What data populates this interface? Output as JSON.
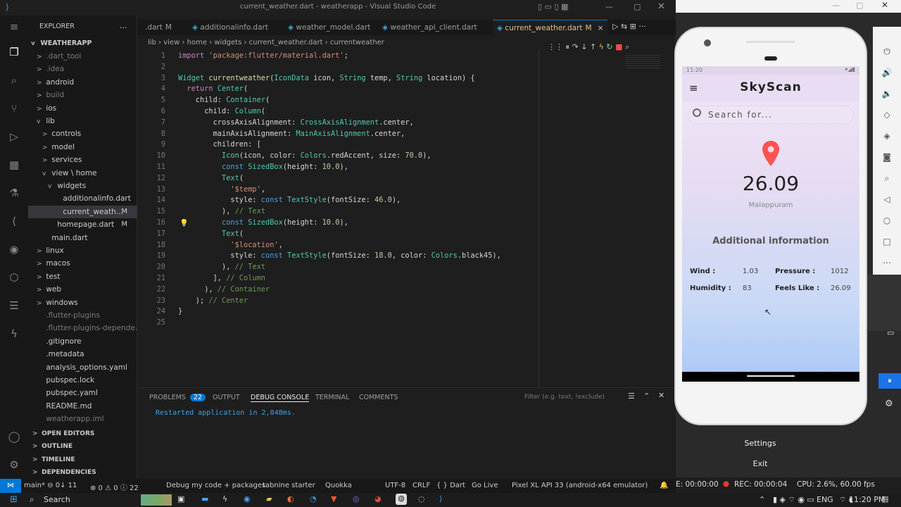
{
  "window_title": "current_weather.dart - weatherapp - Visual Studio Code",
  "explorer_label": "EXPLORER",
  "explorer_more": "...",
  "project": "WEATHERAPP",
  "tree": [
    {
      "label": ".dart_tool",
      "dim": true,
      "chev": ">"
    },
    {
      "label": ".idea",
      "dim": true,
      "chev": ">"
    },
    {
      "label": "android",
      "chev": ">"
    },
    {
      "label": "build",
      "dim": true,
      "chev": ">"
    },
    {
      "label": "ios",
      "chev": ">"
    },
    {
      "label": "lib",
      "chev": "v"
    },
    {
      "label": "controls",
      "chev": ">"
    },
    {
      "label": "model",
      "chev": ">"
    },
    {
      "label": "services",
      "chev": ">"
    },
    {
      "label": "view \\ home",
      "chev": "v"
    },
    {
      "label": "widgets",
      "chev": "v"
    },
    {
      "label": "additionalinfo.dart",
      "chev": ""
    },
    {
      "label": "current_weath...",
      "chev": "",
      "m": "M",
      "sel": true
    },
    {
      "label": "homepage.dart",
      "chev": "",
      "m": "M"
    },
    {
      "label": "main.dart",
      "chev": ""
    },
    {
      "label": "linux",
      "chev": ">"
    },
    {
      "label": "macos",
      "chev": ">"
    },
    {
      "label": "test",
      "chev": ">"
    },
    {
      "label": "web",
      "chev": ">"
    },
    {
      "label": "windows",
      "chev": ">"
    },
    {
      "label": ".flutter-plugins",
      "dim": true,
      "chev": ""
    },
    {
      "label": ".flutter-plugins-depende...",
      "dim": true,
      "chev": ""
    },
    {
      "label": ".gitignore",
      "chev": ""
    },
    {
      "label": ".metadata",
      "chev": ""
    },
    {
      "label": "analysis_options.yaml",
      "chev": ""
    },
    {
      "label": "pubspec.lock",
      "chev": ""
    },
    {
      "label": "pubspec.yaml",
      "chev": ""
    },
    {
      "label": "README.md",
      "chev": ""
    },
    {
      "label": "weatherapp.iml",
      "dim": true,
      "chev": ""
    }
  ],
  "sections": [
    "OPEN EDITORS",
    "OUTLINE",
    "TIMELINE",
    "DEPENDENCIES"
  ],
  "tabs": [
    {
      "label": ".dart",
      "m": "M"
    },
    {
      "label": "additionalinfo.dart"
    },
    {
      "label": "weather_model.dart"
    },
    {
      "label": "weather_api_client.dart"
    },
    {
      "label": "current_weather.dart",
      "m": "M",
      "active": true
    }
  ],
  "tab_close": "×",
  "breadcrumb": [
    "lib",
    "view",
    "home",
    "widgets",
    "current_weather.dart",
    "currentweather"
  ],
  "code_lines": [
    "import 'package:flutter/material.dart';",
    "",
    "Widget currentweather(IconData icon, String temp, String location) {",
    "  return Center(",
    "    child: Container(",
    "      child: Column(",
    "        crossAxisAlignment: CrossAxisAlignment.center,",
    "        mainAxisAlignment: MainAxisAlignment.center,",
    "        children: [",
    "          Icon(icon, color: Colors.redAccent, size: 70.0),",
    "          const SizedBox(height: 10.0),",
    "          Text(",
    "            '$temp',",
    "            style: const TextStyle(fontSize: 46.0),",
    "          ), // Text",
    "          const SizedBox(height: 10.0),",
    "          Text(",
    "            '$location',",
    "            style: const TextStyle(fontSize: 18.0, color: Colors.black45),",
    "          ), // Text",
    "        ], // Column",
    "      ), // Container",
    "    ); // Center",
    "}",
    ""
  ],
  "panel_tabs": [
    {
      "label": "PROBLEMS",
      "badge": "22"
    },
    {
      "label": "OUTPUT"
    },
    {
      "label": "DEBUG CONSOLE",
      "active": true
    },
    {
      "label": "TERMINAL"
    },
    {
      "label": "COMMENTS"
    }
  ],
  "filter_placeholder": "Filter (e.g. text, !exclude)",
  "console_output": "Restarted application in 2,848ms.",
  "status": {
    "branch": "main* ⊖ 0↓ 11",
    "problems": "⊗ 0 ⚠ 0 ⓘ 22",
    "debug": "Debug my code + packages",
    "tabnine": "tabnine starter",
    "quokka": "Quokka",
    "encoding": "UTF-8",
    "eol": "CRLF",
    "lang": "{ } Dart",
    "golive": "Go Live",
    "device": "Pixel XL API 33 (android-x64 emulator)"
  },
  "app": {
    "time": "11:20",
    "title": "SkyScan",
    "search_placeholder": "Search for...",
    "temp": "26.09",
    "location": "Malappuram",
    "section": "Additional information",
    "rows": [
      {
        "k1": "Wind :",
        "v1": "1.03",
        "k2": "Pressure :",
        "v2": "1012"
      },
      {
        "k1": "Humidity :",
        "v1": "83",
        "k2": "Feels Like :",
        "v2": "26.09"
      }
    ],
    "pin_color": "#ff5252"
  },
  "recorder": {
    "settings": "Settings",
    "exit": "Exit",
    "time": "E: 00:00:00",
    "rec": "REC: 00:00:04",
    "cpu": "CPU: 2.6%, 60.00 fps"
  },
  "taskbar": {
    "search": "Search",
    "lang": "ENG",
    "time": "11:20 PM"
  }
}
